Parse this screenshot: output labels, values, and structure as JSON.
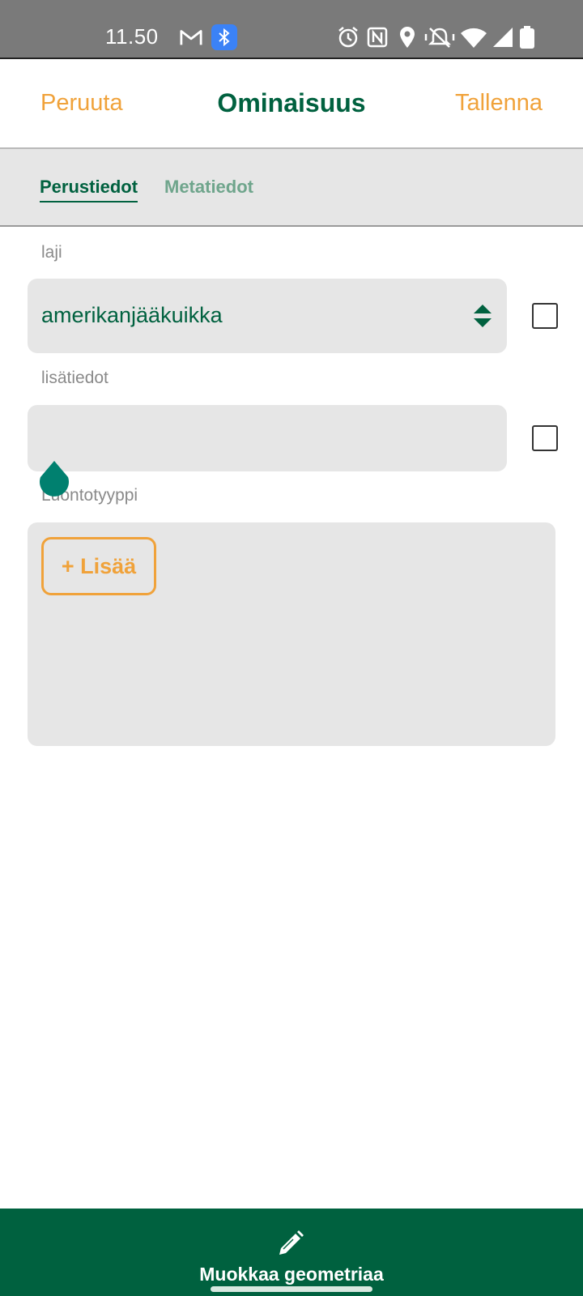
{
  "status_bar": {
    "time": "11.50",
    "icons": [
      "gmail-icon",
      "bluetooth-icon",
      "alarm-icon",
      "nfc-icon",
      "location-icon",
      "vibrate-icon",
      "wifi-icon",
      "signal-icon",
      "battery-icon"
    ]
  },
  "header": {
    "cancel_label": "Peruuta",
    "title": "Ominaisuus",
    "save_label": "Tallenna"
  },
  "tabs": [
    {
      "label": "Perustiedot",
      "active": true
    },
    {
      "label": "Metatiedot",
      "active": false
    }
  ],
  "form": {
    "laji": {
      "label": "laji",
      "value": "amerikanjääkuikka"
    },
    "lisatiedot": {
      "label": "lisätiedot",
      "value": ""
    },
    "luontotyyppi": {
      "label": "Luontotyyppi",
      "add_button": "+ Lisää"
    }
  },
  "bottom_bar": {
    "label": "Muokkaa geometriaa"
  },
  "colors": {
    "brand_green": "#00613f",
    "accent_orange": "#f0a23a",
    "field_bg": "#e6e6e6",
    "handle_teal": "#00806f"
  }
}
